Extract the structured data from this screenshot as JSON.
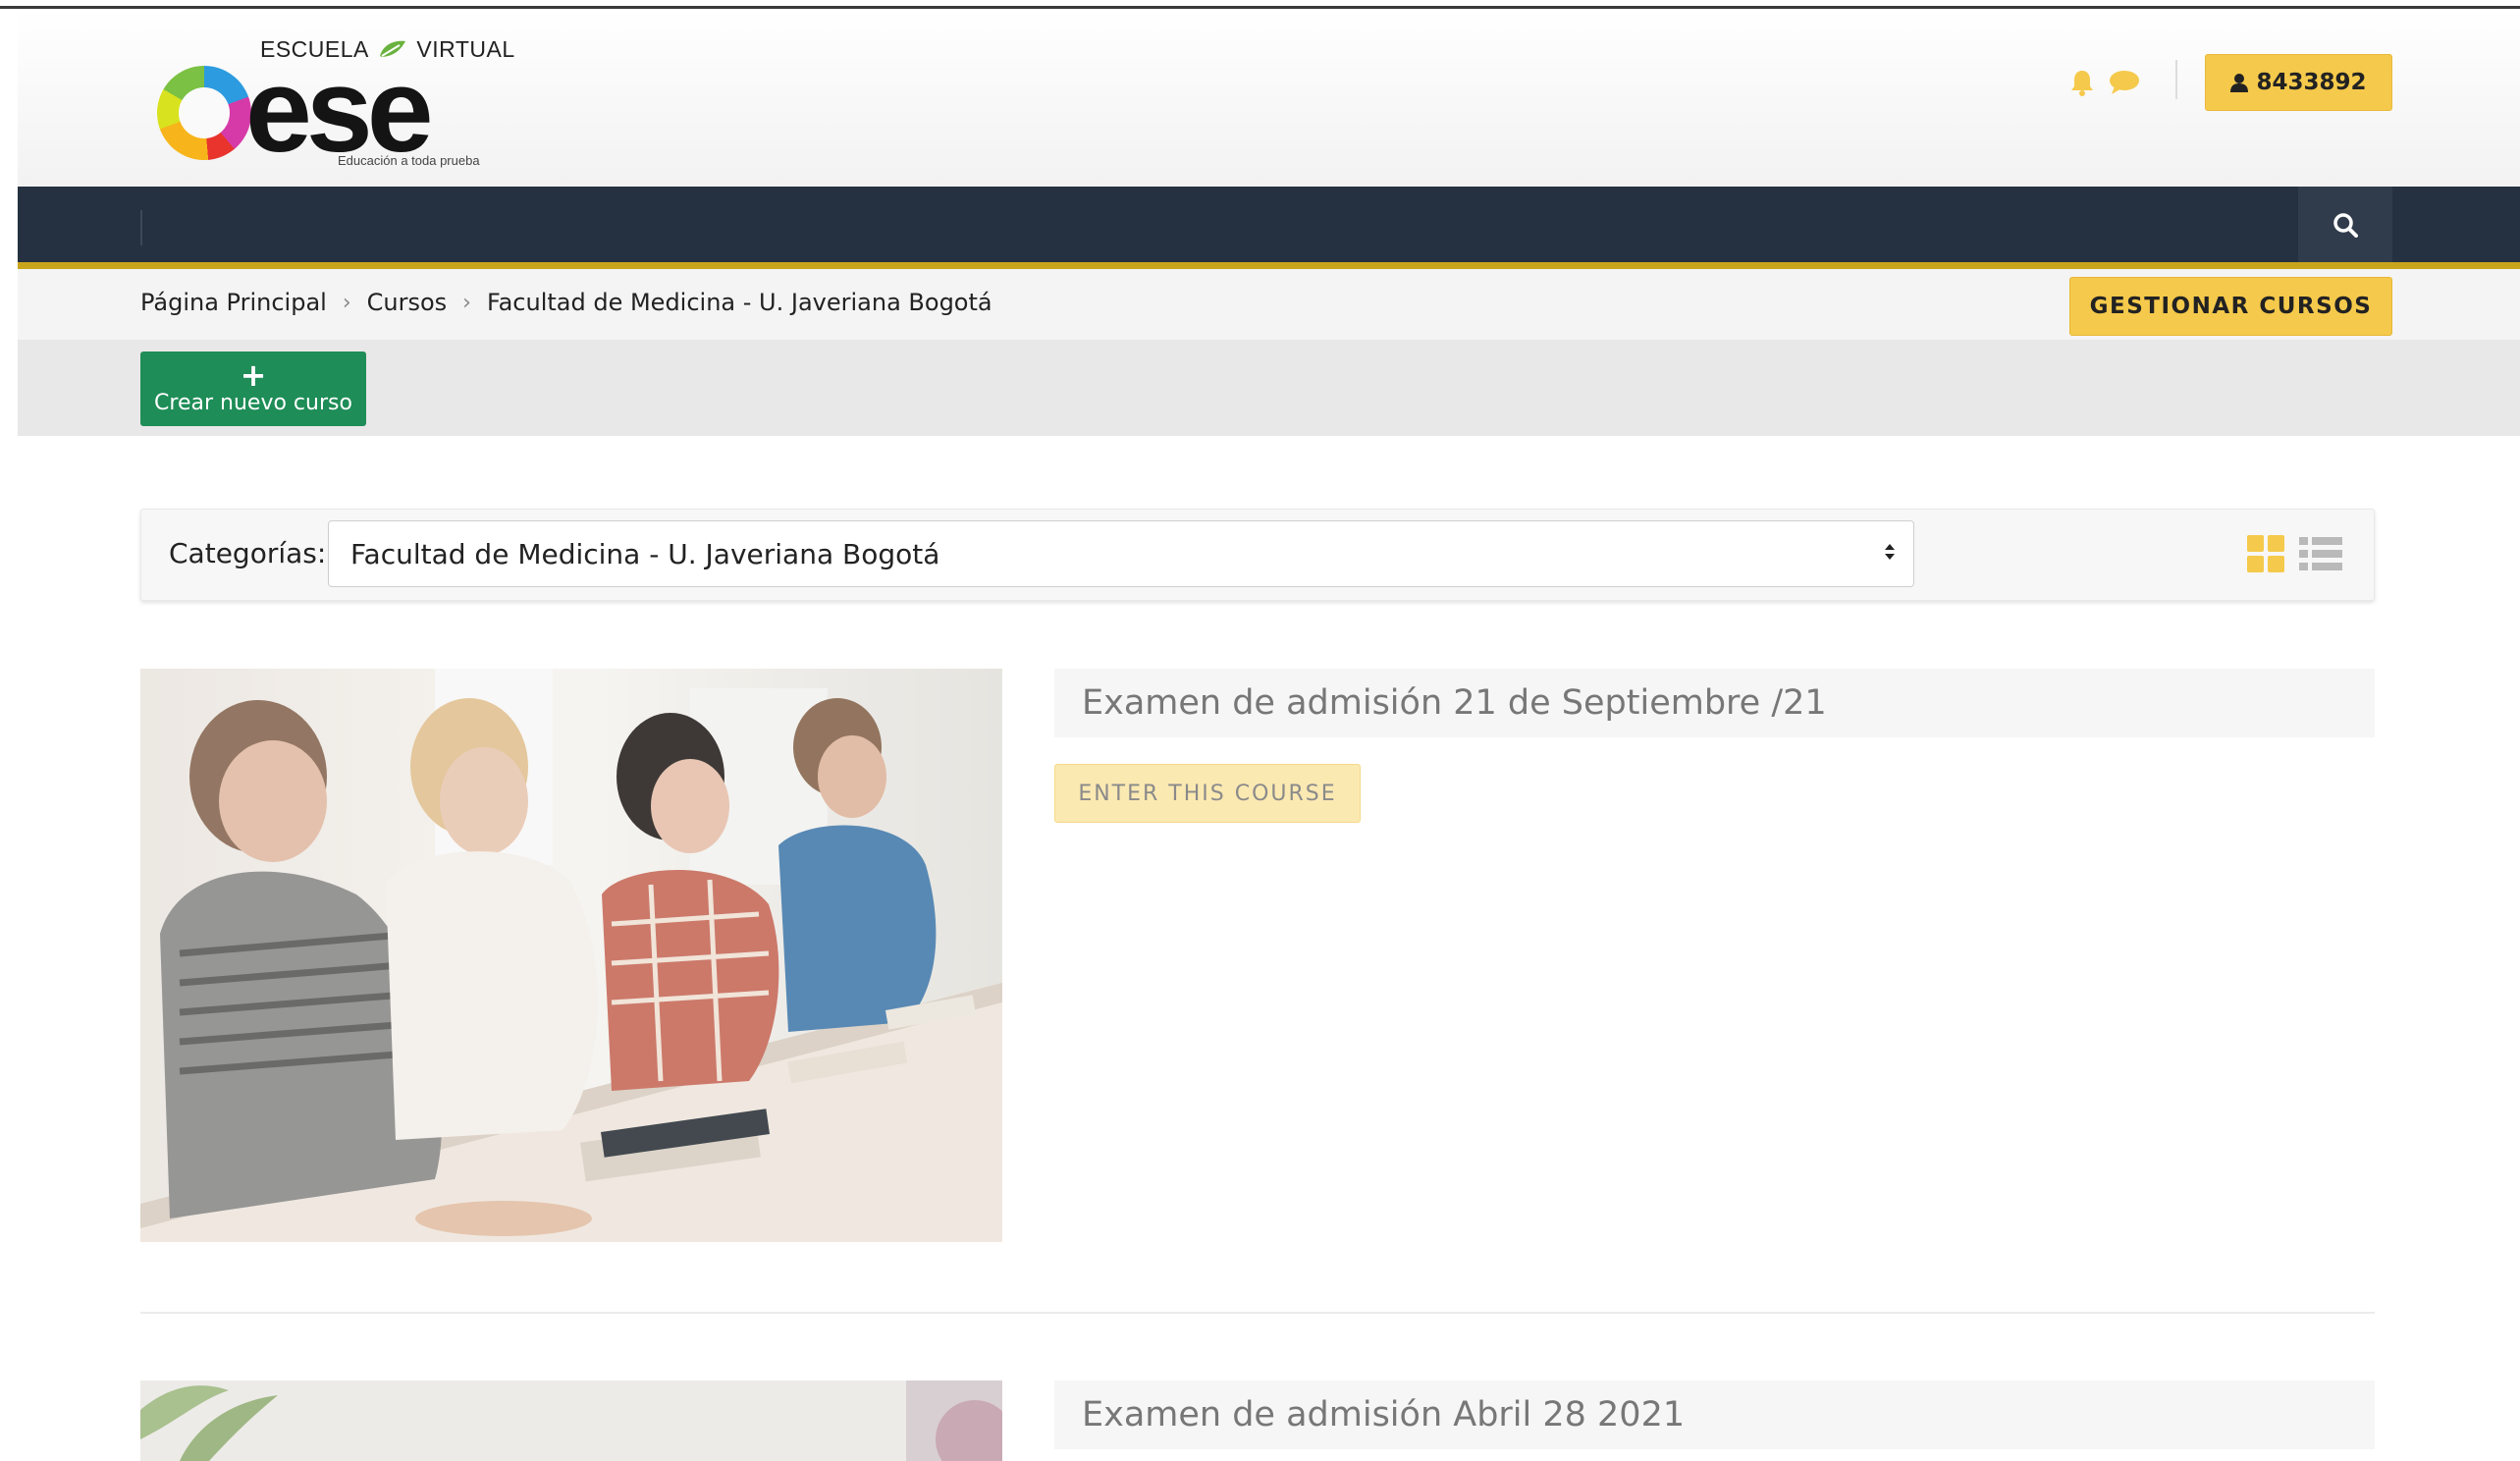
{
  "header": {
    "logo_top_left": "ESCUELA",
    "logo_top_right": "VIRTUAL",
    "logo_word": "ese",
    "logo_tagline": "Educación a toda prueba",
    "user_id": "8433892"
  },
  "breadcrumb": {
    "items": [
      "Página Principal",
      "Cursos",
      "Facultad de Medicina - U. Javeriana Bogotá"
    ]
  },
  "manage_courses_label": "GESTIONAR CURSOS",
  "create_course": {
    "icon": "+",
    "label": "Crear nuevo curso"
  },
  "filter": {
    "label": "Categorías:",
    "selected": "Facultad de Medicina - U. Javeriana Bogotá"
  },
  "courses": [
    {
      "title": "Examen de admisión 21 de Septiembre /21",
      "button": "ENTER THIS COURSE"
    },
    {
      "title": "Examen de admisión Abril 28 2021"
    }
  ],
  "colors": {
    "accent": "#f5c94b",
    "nav_bg": "#253140",
    "nav_border": "#c9a51c",
    "create_btn": "#1e8d57"
  }
}
